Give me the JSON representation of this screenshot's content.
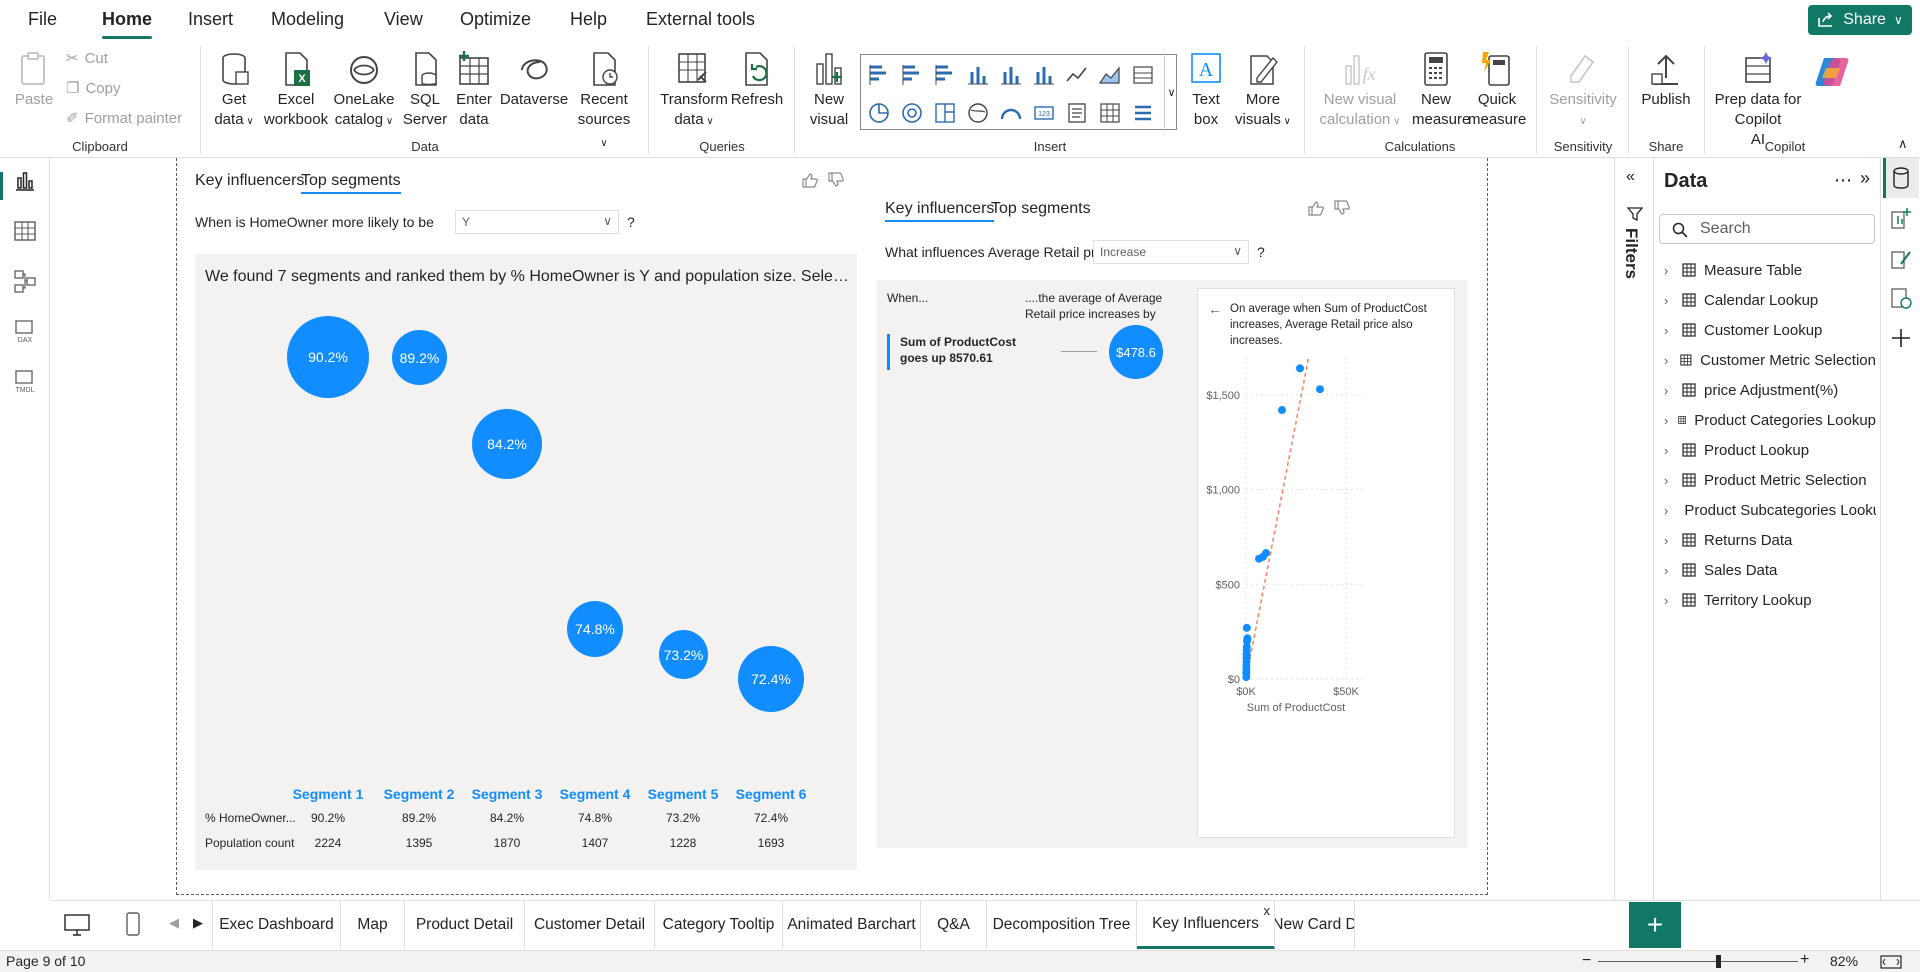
{
  "menu": {
    "items": [
      "File",
      "Home",
      "Insert",
      "Modeling",
      "View",
      "Optimize",
      "Help",
      "External tools"
    ],
    "active": "Home",
    "share_label": "Share"
  },
  "ribbon": {
    "clipboard": {
      "paste": "Paste",
      "cut": "Cut",
      "copy": "Copy",
      "format_painter": "Format painter",
      "group": "Clipboard"
    },
    "data": {
      "get_data": [
        "Get",
        "data"
      ],
      "excel": [
        "Excel",
        "workbook"
      ],
      "onelake": [
        "OneLake",
        "catalog"
      ],
      "sql": [
        "SQL",
        "Server"
      ],
      "enter": [
        "Enter",
        "data"
      ],
      "dataverse": "Dataverse",
      "recent": [
        "Recent",
        "sources"
      ],
      "group": "Data"
    },
    "queries": {
      "transform": [
        "Transform",
        "data"
      ],
      "refresh": "Refresh",
      "group": "Queries"
    },
    "insert": {
      "new_visual": [
        "New",
        "visual"
      ],
      "text_box": [
        "Text",
        "box"
      ],
      "more_visuals": [
        "More",
        "visuals"
      ],
      "group": "Insert"
    },
    "calculations": {
      "new_visual_calc": [
        "New visual",
        "calculation"
      ],
      "new_measure": [
        "New",
        "measure"
      ],
      "quick_measure": [
        "Quick",
        "measure"
      ],
      "group": "Calculations"
    },
    "sensitivity": {
      "label": "Sensitivity",
      "group": "Sensitivity"
    },
    "share": {
      "publish": "Publish",
      "group": "Share"
    },
    "copilot": {
      "prep": [
        "Prep data for Copilot",
        "AI"
      ],
      "group": "Copilot"
    }
  },
  "left_visual": {
    "tabs": [
      "Key influencers",
      "Top segments"
    ],
    "active_tab": "Top segments",
    "question": "When is HomeOwner more likely to be",
    "dropdown_value": "Y",
    "qmark": "?",
    "summary": "We found 7 segments and ranked them by % HomeOwner is Y and population size. Select a segment to see more details.",
    "row_labels": [
      "% HomeOwner...",
      "Population count"
    ],
    "segments": [
      {
        "name": "Segment 1",
        "pct": "90.2%",
        "pct_value": 90.2,
        "pop": "2224"
      },
      {
        "name": "Segment 2",
        "pct": "89.2%",
        "pct_value": 89.2,
        "pop": "1395"
      },
      {
        "name": "Segment 3",
        "pct": "84.2%",
        "pct_value": 84.2,
        "pop": "1870"
      },
      {
        "name": "Segment 4",
        "pct": "74.8%",
        "pct_value": 74.8,
        "pop": "1407"
      },
      {
        "name": "Segment 5",
        "pct": "73.2%",
        "pct_value": 73.2,
        "pop": "1228"
      },
      {
        "name": "Segment 6",
        "pct": "72.4%",
        "pct_value": 72.4,
        "pop": "1693"
      }
    ]
  },
  "right_visual": {
    "tabs": [
      "Key influencers",
      "Top segments"
    ],
    "active_tab": "Key influencers",
    "question": "What influences Average Retail price to",
    "dropdown_value": "Increase",
    "qmark": "?",
    "when_label": "When...",
    "then_label": "....the average of Average Retail price increases by",
    "factor": "Sum of ProductCost goes up 8570.61",
    "impact": "$478.6",
    "detail_text": "On average when Sum of ProductCost increases, Average Retail price also increases."
  },
  "chart_data": {
    "type": "scatter",
    "xlabel": "Sum of ProductCost",
    "ylabel": "",
    "x_ticks": [
      "$0K",
      "$50K"
    ],
    "y_ticks": [
      "$0",
      "$500",
      "$1,000",
      "$1,500"
    ],
    "xlim": [
      0,
      50000
    ],
    "ylim": [
      0,
      1700
    ],
    "grid": true,
    "points": [
      {
        "x": 150,
        "y": 10
      },
      {
        "x": 150,
        "y": 30
      },
      {
        "x": 200,
        "y": 50
      },
      {
        "x": 200,
        "y": 70
      },
      {
        "x": 250,
        "y": 90
      },
      {
        "x": 300,
        "y": 110
      },
      {
        "x": 300,
        "y": 130
      },
      {
        "x": 350,
        "y": 150
      },
      {
        "x": 400,
        "y": 170
      },
      {
        "x": 500,
        "y": 200
      },
      {
        "x": 700,
        "y": 215
      },
      {
        "x": 400,
        "y": 270
      },
      {
        "x": 6500,
        "y": 635
      },
      {
        "x": 8500,
        "y": 645
      },
      {
        "x": 10000,
        "y": 665
      },
      {
        "x": 18000,
        "y": 1420
      },
      {
        "x": 27000,
        "y": 1640
      },
      {
        "x": 37000,
        "y": 1530
      }
    ],
    "trend": [
      {
        "x": 0,
        "y": 0
      },
      {
        "x": 33000,
        "y": 1790
      }
    ]
  },
  "data_pane": {
    "title": "Data",
    "search_placeholder": "Search",
    "tables": [
      "Measure Table",
      "Calendar Lookup",
      "Customer Lookup",
      "Customer Metric Selection",
      "price Adjustment(%)",
      "Product Categories Lookup",
      "Product Lookup",
      "Product Metric Selection",
      "Product Subcategories Lookup",
      "Returns Data",
      "Sales Data",
      "Territory Lookup"
    ]
  },
  "filters_label": "Filters",
  "page_tabs": {
    "tabs": [
      "Exec Dashboard",
      "Map",
      "Product Detail",
      "Customer Detail",
      "Category Tooltip",
      "Animated Barchart",
      "Q&A",
      "Decomposition Tree",
      "Key Influencers",
      "New Card D"
    ],
    "active": "Key Influencers",
    "close": "x"
  },
  "status": {
    "page": "Page 9 of 10",
    "zoom": "82%"
  },
  "colors": {
    "accent": "#117865",
    "visual_blue": "#118dff",
    "trend": "#f08a6e"
  }
}
